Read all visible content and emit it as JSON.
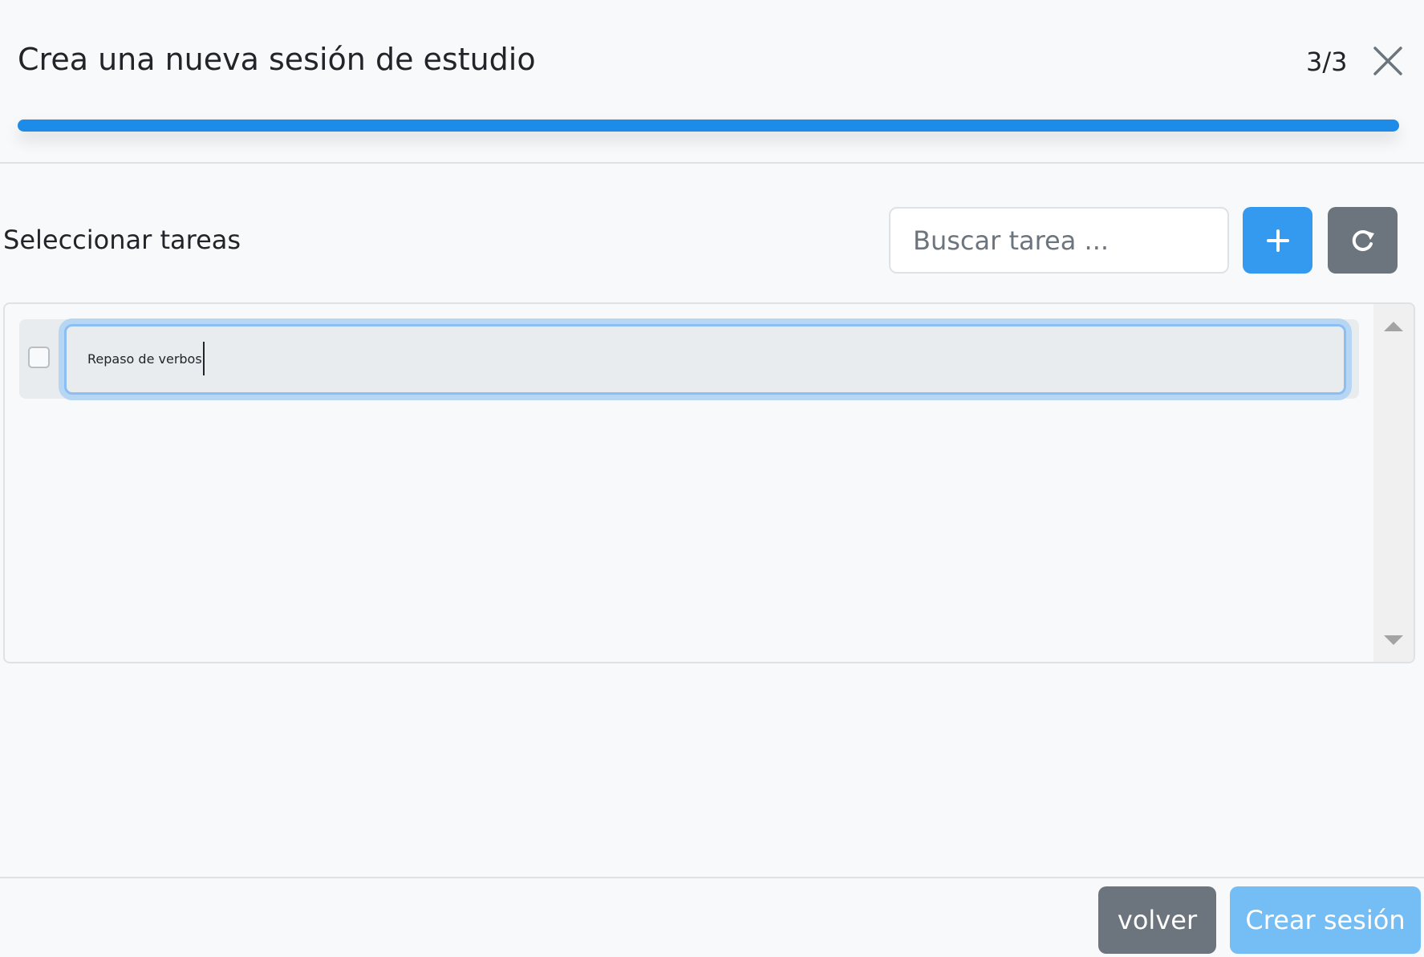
{
  "header": {
    "title": "Crea una nueva sesión de estudio",
    "step": "3/3",
    "progress_fraction": 1.0,
    "accent_color": "#1d8ce8"
  },
  "toolbar": {
    "label": "Seleccionar tareas",
    "search_placeholder": "Buscar tarea ...",
    "search_value": "",
    "add_icon": "plus-icon",
    "refresh_icon": "refresh-icon"
  },
  "tasks": [
    {
      "text": "Repaso de verbos",
      "checked": false,
      "editing": true
    }
  ],
  "footer": {
    "back_label": "volver",
    "create_label": "Crear sesión"
  }
}
